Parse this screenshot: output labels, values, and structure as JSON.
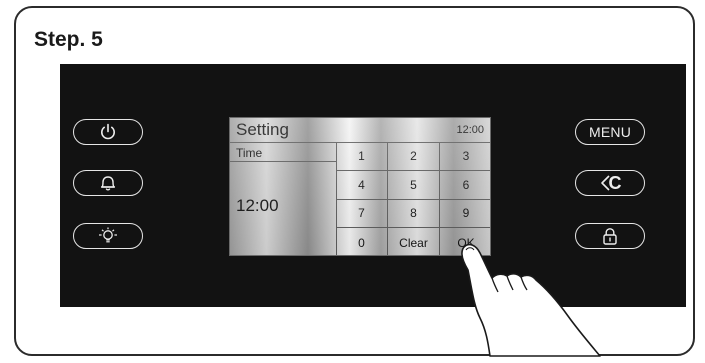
{
  "step": {
    "title": "Step. 5"
  },
  "left_buttons": [
    {
      "name": "power-button",
      "icon": "power-icon"
    },
    {
      "name": "alarm-button",
      "icon": "bell-icon"
    },
    {
      "name": "light-button",
      "icon": "light-bulb-icon"
    }
  ],
  "right_buttons": {
    "menu_label": "MENU",
    "back_label": "C",
    "back_icon": "back-chevron-icon",
    "lock_icon": "lock-icon"
  },
  "screen": {
    "title": "Setting",
    "clock": "12:00",
    "field_label": "Time",
    "field_value": "12:00",
    "keys": [
      "1",
      "2",
      "3",
      "4",
      "5",
      "6",
      "7",
      "8",
      "9",
      "0",
      "Clear",
      "OK"
    ]
  },
  "colors": {
    "panel": "#121212",
    "button_outline": "#e6e6e6",
    "frame": "#2b2b2b"
  }
}
